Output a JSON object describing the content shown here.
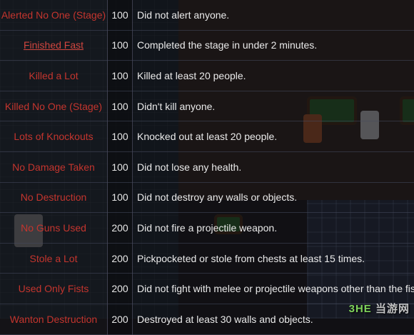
{
  "table": {
    "rows": [
      {
        "name": "Alerted No One (Stage)",
        "points": "100",
        "description": "Did not alert anyone."
      },
      {
        "name": "Finished Fast",
        "points": "100",
        "description": "Completed the stage in under 2 minutes."
      },
      {
        "name": "Killed a Lot",
        "points": "100",
        "description": "Killed at least 20 people."
      },
      {
        "name": "Killed No One (Stage)",
        "points": "100",
        "description": "Didn't kill anyone."
      },
      {
        "name": "Lots of Knockouts",
        "points": "100",
        "description": "Knocked out at least 20 people."
      },
      {
        "name": "No Damage Taken",
        "points": "100",
        "description": "Did not lose any health."
      },
      {
        "name": "No Destruction",
        "points": "100",
        "description": "Did not destroy any walls or objects."
      },
      {
        "name": "No Guns Used",
        "points": "200",
        "description": "Did not fire a projectile weapon."
      },
      {
        "name": "Stole a Lot",
        "points": "200",
        "description": "Pickpocketed or stole from chests at least 15 times."
      },
      {
        "name": "Used Only Fists",
        "points": "200",
        "description": "Did not fight with melee or projectile weapons other than the fist."
      },
      {
        "name": "Wanton Destruction",
        "points": "200",
        "description": "Destroyed at least 30 walls and objects."
      }
    ]
  },
  "watermark": {
    "brand": "3HE",
    "site": "当游网"
  },
  "colors": {
    "name_text": "#c4352e",
    "value_text": "#e6e6e6",
    "desc_text": "#eaeaea"
  }
}
